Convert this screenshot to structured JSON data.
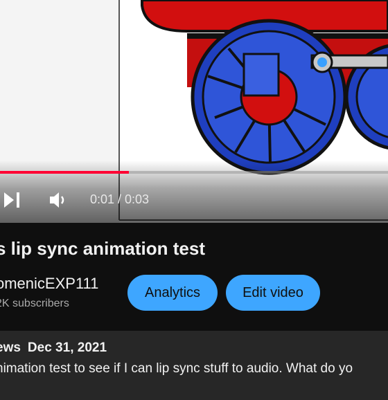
{
  "player": {
    "progress_fraction": 0.333,
    "time_display": "0:01 / 0:03",
    "accent_color": "#ff0033",
    "icons": [
      "skip-next-icon",
      "volume-icon"
    ]
  },
  "video": {
    "title": "s lip sync animation test",
    "channel": "omenicEXP111",
    "subscribers": "2K subscribers",
    "analytics_label": "Analytics",
    "edit_label": "Edit video",
    "button_color": "#3ea6ff",
    "views": "ews",
    "date": "Dec 31, 2021",
    "description": "nimation test to see if I can lip sync stuff to audio.  What do yo"
  }
}
